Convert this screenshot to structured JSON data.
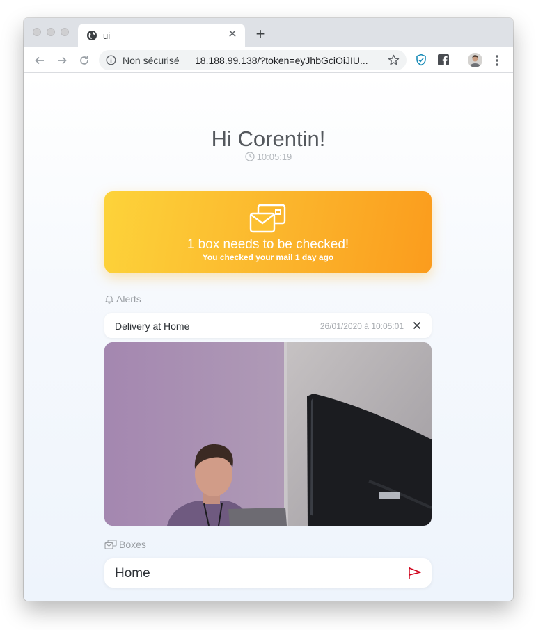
{
  "browser": {
    "tab_title": "ui",
    "not_secure_label": "Non sécurisé",
    "url": "18.188.99.138/?token=eyJhbGciOiJIU..."
  },
  "header": {
    "greeting": "Hi Corentin!",
    "time": "10:05:19"
  },
  "hero": {
    "title": "1 box needs to be checked!",
    "subtitle": "You checked your mail 1 day ago",
    "icon": "mail-boxes-icon"
  },
  "alerts": {
    "label": "Alerts",
    "items": [
      {
        "title": "Delivery at Home",
        "timestamp": "26/01/2020 à 10:05:01"
      }
    ]
  },
  "boxes": {
    "label": "Boxes",
    "items": [
      {
        "name": "Home",
        "status_icon": "flag-icon",
        "status_color": "#d0021b"
      }
    ]
  },
  "colors": {
    "accent_start": "#fdd33a",
    "accent_end": "#fb9c1d"
  }
}
